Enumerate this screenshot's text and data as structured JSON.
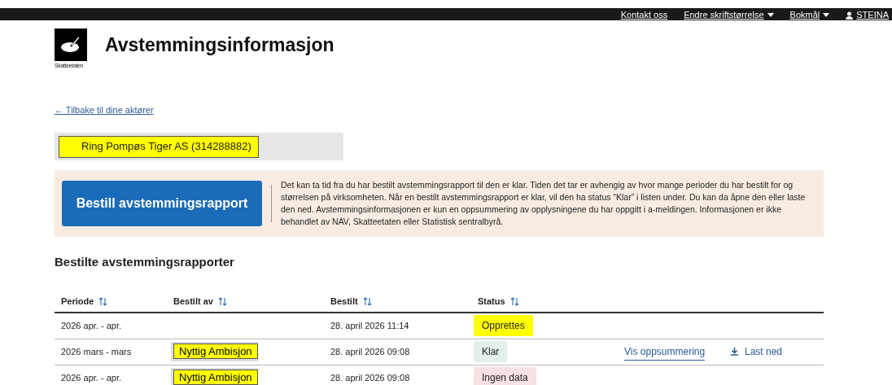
{
  "top_bar": {
    "links": [
      {
        "label": "Kontakt oss",
        "kind": "link"
      },
      {
        "label": "Endre skriftstørrelse",
        "kind": "menu"
      },
      {
        "label": "Bokmål",
        "kind": "menu"
      },
      {
        "label": "STEINA",
        "kind": "user"
      }
    ]
  },
  "header": {
    "logo_text": "Skatteetaten",
    "title": "Avstemmingsinformasjon"
  },
  "back_link": "← Tilbake til dine aktører",
  "organization": {
    "name": "Ring Pompøs Tiger AS (314288882)",
    "highlighted": true
  },
  "info": {
    "button": "Bestill avstemmingsrapport",
    "text": "Det kan ta tid fra du har bestilt avstemmingsrapport til den er klar. Tiden det tar er avhengig av hvor mange perioder du har bestilt for og størrelsen på virksomheten. Når en bestilt avstemmingsrapport er klar, vil den ha status “Klar” i listen under. Du kan da åpne den eller laste den ned. Avstemmingsinformasjonen er kun en oppsummering av opplysningene du har oppgitt i a-meldingen. Informasjonen er ikke behandlet av NAV, Skatteetaten eller Statistisk sentralbyrå."
  },
  "section_title": "Bestilte avstemmingsrapporter",
  "table": {
    "columns": [
      "Periode",
      "Bestilt av",
      "Bestilt",
      "Status"
    ],
    "rows": [
      {
        "periode": "2026 apr. - apr.",
        "bestilt": "28. april 2026 11:14",
        "status": {
          "label": "Opprettes",
          "color": "#ffff00"
        }
      },
      {
        "periode": "2026 mars - mars",
        "bestilt_av": {
          "name": "Nyttig Ambisjon",
          "highlighted": true
        },
        "bestilt": "28. april 2026 09:08",
        "status": {
          "label": "Klar",
          "color": "#e3efe9"
        },
        "summary_link": "Vis oppsummering",
        "download_link": "Last ned"
      },
      {
        "periode": "2026 apr. - apr.",
        "bestilt_av": {
          "name": "Nyttig Ambisjon",
          "highlighted": true
        },
        "bestilt": "28. april 2026 09:08",
        "status": {
          "label": "Ingen data",
          "color": "#f7e1e3"
        }
      }
    ]
  }
}
